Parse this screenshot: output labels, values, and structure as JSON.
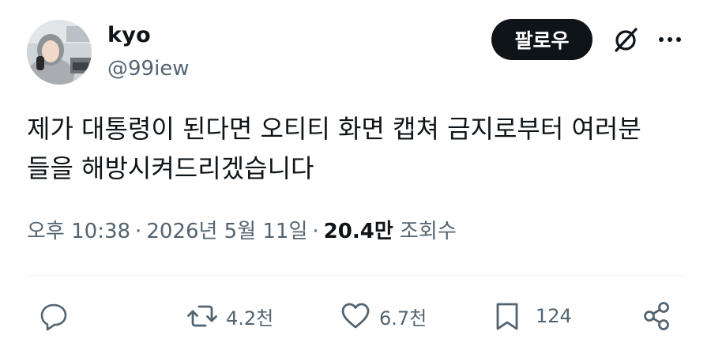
{
  "author": {
    "display_name": "kyo",
    "handle": "@99iew"
  },
  "header": {
    "follow_label": "팔로우"
  },
  "tweet": {
    "lines": [
      "제가 대통령이 된다면 오티티 화면 캡쳐 금지로부터 여러분",
      "들을 해방시켜드리겠습니다"
    ]
  },
  "meta": {
    "time": "오후 10:38",
    "separator": "·",
    "date": "2026년 5월 11일",
    "views_count": "20.4만",
    "views_label": "조회수"
  },
  "actions": {
    "reposts": "4.2천",
    "likes": "6.7천",
    "bookmarks": "124"
  },
  "icons": {
    "reply": "reply-icon",
    "repost": "repost-icon",
    "like": "heart-icon",
    "bookmark": "bookmark-icon",
    "share": "share-icon",
    "grok": "grok-icon",
    "more": "more-icon"
  },
  "colors": {
    "text": "#0f1419",
    "secondary": "#536471",
    "follow_bg": "#0f1419",
    "divider": "#eff3f4"
  }
}
